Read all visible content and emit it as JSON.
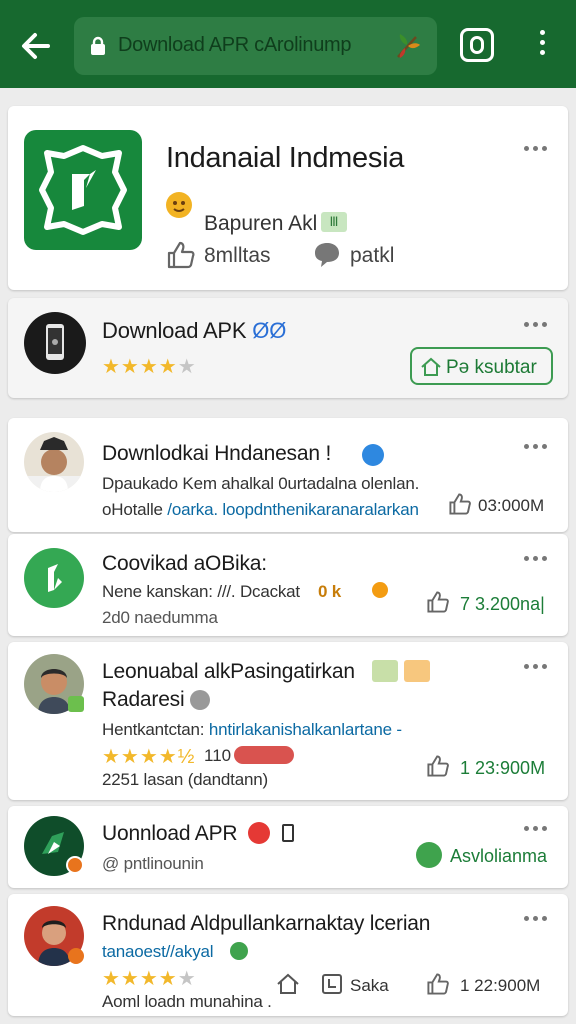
{
  "browser": {
    "url_text": "Download APR cArolinump",
    "colors": {
      "toolbar": "#17692f",
      "url_field": "#2e7d44"
    }
  },
  "app_header": {
    "title": "Indanaial Indmesia",
    "developer": "Bapuren Akl",
    "developer_tag": "Ⅲ",
    "likes_label": "8mlltas",
    "comments_label": "patkl"
  },
  "download_card": {
    "title": "Download APK",
    "title_suffix": "ØØ",
    "rating": 4,
    "button_label": "Pǝ ksubtar"
  },
  "feed": [
    {
      "title": "Downlodkai Hndanesan !",
      "line1": "Dpaukado Kem ahalkal 0urtadalna olenlan.",
      "line2_prefix": "oHotalle ",
      "line2_link": "/oarka. loopdnthenikaranaralarkan",
      "count": "03:000M"
    },
    {
      "title": "Coovikad aOBika:",
      "line1": "Nene kanskan: ///. Dcackat",
      "line1_badge": "0 k",
      "line2": "2d0 naedumma",
      "count": "7  3.200na|"
    },
    {
      "title": "Leonuabal alkPasingatirkan",
      "title_line2": "Radaresi",
      "line1_prefix": "Hentkantctan: ",
      "line1_link": "hntirlakanishalkanlartane -",
      "rating_value": "110",
      "rating": 4.5,
      "line3": "2251 lasan (dandtann)",
      "count": "1  23:900M"
    },
    {
      "title": "Uonnload APR",
      "subtitle": "@ pntlinounin",
      "action_label": "Asvlolianma"
    },
    {
      "title": "Rndunad Aldpullankarnaktay lcerian",
      "line1_link": "tanaoest//akyal",
      "rating": 4,
      "line3": "Aoml loadn munahina .",
      "share_label": "Saka",
      "count": "1  22:900M"
    }
  ]
}
